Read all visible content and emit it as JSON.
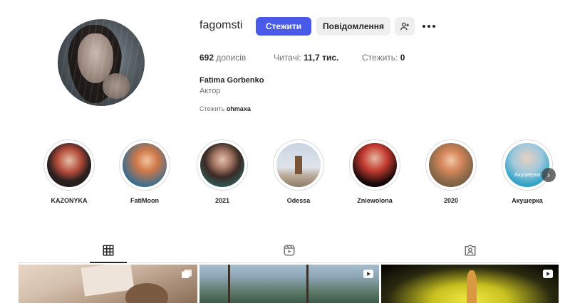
{
  "profile": {
    "username": "fagomsti",
    "follow_label": "Стежити",
    "message_label": "Повідомлення",
    "posts_count": "692",
    "posts_label": "дописів",
    "followers_label": "Читачі:",
    "followers_count": "11,7 тис.",
    "following_label": "Стежить:",
    "following_count": "0",
    "full_name": "Fatima Gorbenko",
    "category": "Актор",
    "followed_by_prefix": "Стежить",
    "followed_by_user": "ohmaxa"
  },
  "highlights": [
    {
      "label": "KAZONYKA"
    },
    {
      "label": "FatiMoon"
    },
    {
      "label": "2021"
    },
    {
      "label": "Odessa"
    },
    {
      "label": "Zniewolona"
    },
    {
      "label": "2020"
    },
    {
      "label": "Акушерка",
      "thumb_text": "Акушерка"
    }
  ],
  "tabs": [
    {
      "name": "posts",
      "icon": "grid-icon",
      "active": true
    },
    {
      "name": "reels",
      "icon": "reels-icon",
      "active": false
    },
    {
      "name": "tagged",
      "icon": "tagged-icon",
      "active": false
    }
  ],
  "posts": [
    {
      "badge": "carousel-icon"
    },
    {
      "badge": "reel-icon"
    },
    {
      "badge": "reel-icon"
    }
  ],
  "colors": {
    "accent": "#4a5ae8",
    "secondary_button": "#efefef",
    "text": "#262626",
    "muted": "#737373"
  }
}
